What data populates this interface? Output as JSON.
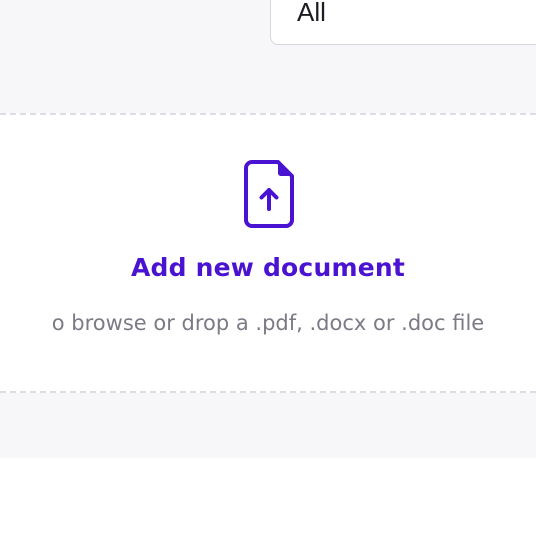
{
  "filter": {
    "selected_value": "All"
  },
  "dropzone": {
    "icon": "file-upload-icon",
    "title": "Add new document",
    "hint": "o browse or drop a .pdf, .docx or .doc file"
  },
  "colors": {
    "accent": "#4a12d1",
    "hint_text": "#7b7b86",
    "panel_bg": "#f7f7f9",
    "dashed_border": "#dcdce2"
  }
}
